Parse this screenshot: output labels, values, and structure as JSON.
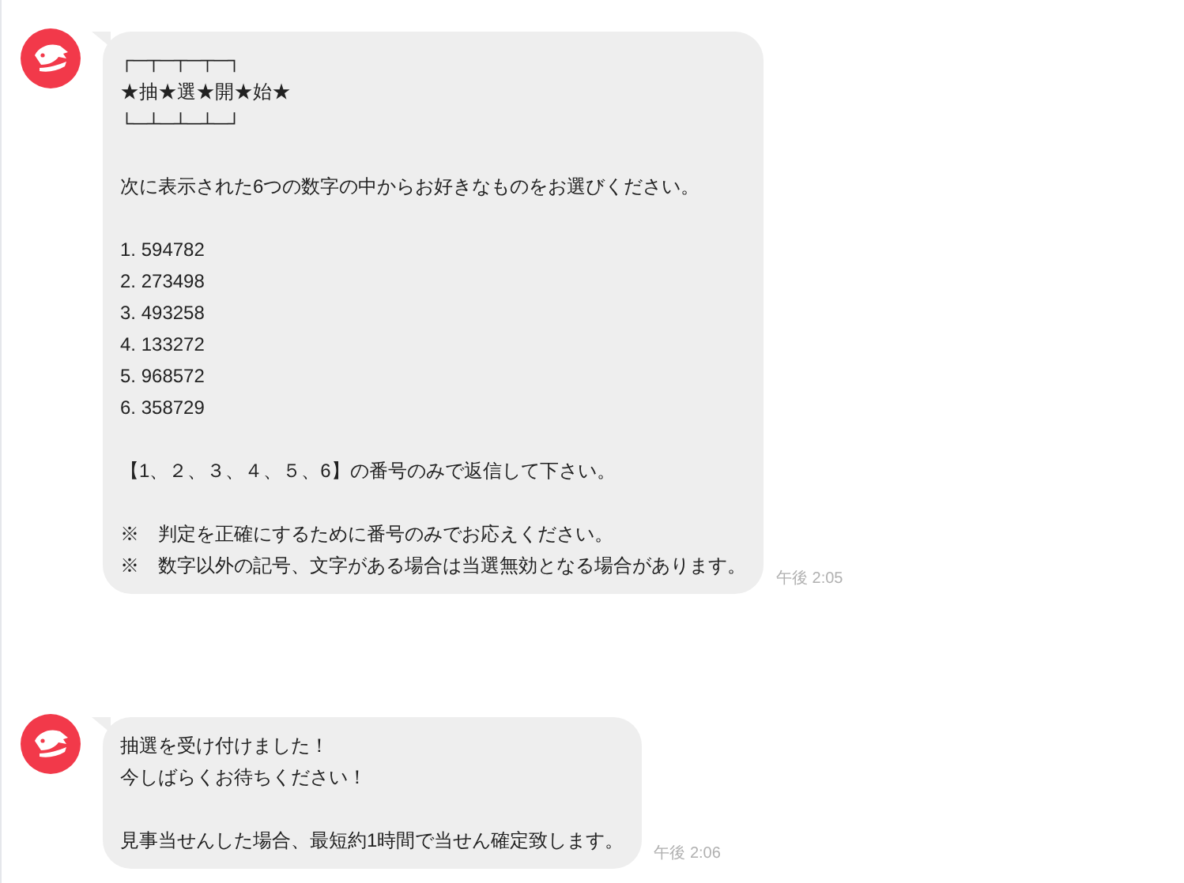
{
  "messages": [
    {
      "paragraphs": [
        [
          "┌─┬─┬─┬─┐",
          "★抽★選★開★始★",
          "└─┴─┴─┴─┘"
        ],
        [
          "次に表示された6つの数字の中からお好きなものをお選びください。"
        ],
        [
          "1. 594782",
          "2. 273498",
          "3. 493258",
          "4. 133272",
          "5. 968572",
          "6. 358729"
        ],
        [
          "【1、２、３、４、５、6】の番号のみで返信して下さい。"
        ],
        [
          "※　判定を正確にするために番号のみでお応えください。",
          "※　数字以外の記号、文字がある場合は当選無効となる場合があります。"
        ]
      ],
      "time": "午後 2:05"
    },
    {
      "paragraphs": [
        [
          "抽選を受け付けました！",
          "今しばらくお待ちください！"
        ],
        [
          "見事当せんした場合、最短約1時間で当せん確定致します。"
        ]
      ],
      "time": "午後 2:06"
    }
  ]
}
